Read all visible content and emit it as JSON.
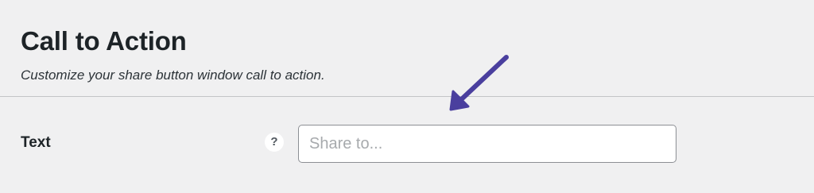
{
  "section": {
    "title": "Call to Action",
    "description": "Customize your share button window call to action."
  },
  "field": {
    "label": "Text",
    "help_glyph": "?",
    "input_value": "",
    "input_placeholder": "Share to..."
  },
  "icons": {
    "help": "question-mark-icon",
    "annotation": "arrow-annotation-icon"
  },
  "colors": {
    "background": "#f0f0f1",
    "text": "#1d2327",
    "divider": "#c3c4c7",
    "input_border": "#8c8f94",
    "placeholder": "#a7aaad",
    "annotation_arrow": "#4a3f9e"
  }
}
